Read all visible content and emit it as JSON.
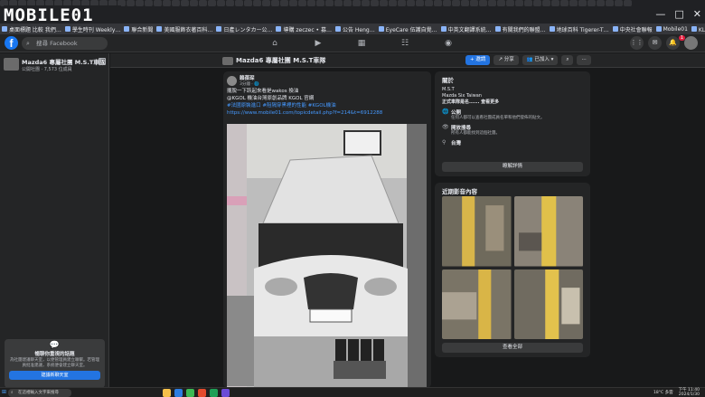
{
  "browser": {
    "site_logo": "MOBILE01",
    "window_controls": [
      "—",
      "□",
      "✕"
    ],
    "bookmarks": [
      "桌面標題 比較 我們…",
      "學生時刊 Weekly…",
      "聯合新聞",
      "美國服飾衣著百科…",
      "日產レンタカー公…",
      "導購 zeczec • 募…",
      "公告 Heng…",
      "EyeCare 伍護自覺…",
      "中英文翻譯系統…",
      "有關我們的聯盟…",
      "地球百科 Tigerer-T…",
      "中央社會聯報",
      "Mobile01",
      "KLOOK客路 - 預訂…",
      "獨立報告大學…",
      "最新資",
      "官方最新 / 讀書"
    ]
  },
  "facebook": {
    "logo": "f",
    "search_placeholder": "搜尋 Facebook",
    "nav_icons": [
      "home-icon",
      "video-icon",
      "marketplace-icon",
      "groups-icon",
      "gaming-icon"
    ],
    "notification_count": "1"
  },
  "left_panel": {
    "group_name": "Mazda6 專屬社團 M.S.T車隊",
    "group_meta": "公開社團 · 7,573 位成員",
    "chat_card": {
      "title": "暢聊你重視的話題",
      "description": "為社團建議聊天室，以便管理員建立聯繫。若管理員批准建議，系統便會建立聊天室。",
      "button": "建議新聊天室"
    }
  },
  "group_bar": {
    "title": "Mazda6 專屬社團 M.S.T車隊",
    "invite_button": "+ 邀請",
    "share_button": "分享",
    "joined_button": "已加入",
    "search_icon": "search-icon",
    "more_icon": "more-icon"
  },
  "post": {
    "author": "賴葆琛",
    "time": "3分鐘 ·",
    "line1": "擺脫一下跃起來看是wakos 換油",
    "line2": "@KGOL 機油台灣原創品牌 KGOL 官網",
    "tags": "#法國原裝進口 #阻隔穿黑裡的性能 #KGOL機油",
    "link": "https://www.mobile01.com/topicdetail.php?f=214&t=6912288"
  },
  "about": {
    "title": "關於",
    "lines": [
      "M.S.T",
      "Mazda Six Taiwan",
      "正式車隊是名...... 查看更多"
    ],
    "public_title": "公開",
    "public_desc": "任何人都可以查看社團成員名單和他們發佈的貼文。",
    "visible_title": "開放搜尋",
    "visible_desc": "所有人都能找到這個社團。",
    "location": "台灣",
    "details_button": "瞭解詳情"
  },
  "media": {
    "title": "近期影音內容",
    "see_all": "查看全部"
  },
  "taskbar": {
    "search_placeholder": "在這裡輸入文字來搜尋",
    "weather": "18°C 多雲",
    "time": "下午 11:40",
    "date": "2024/1/30"
  }
}
